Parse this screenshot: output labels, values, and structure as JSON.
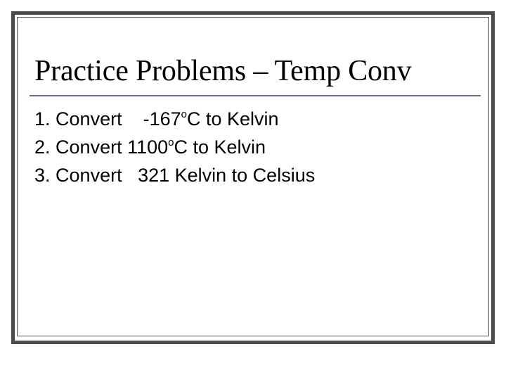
{
  "slide": {
    "title": "Practice Problems – Temp Conv",
    "problems": [
      {
        "number": "1.",
        "pre": " Convert    -167",
        "sup": "o",
        "post": "C to Kelvin"
      },
      {
        "number": "2.",
        "pre": " Convert 1100",
        "sup": "o",
        "post": "C to Kelvin"
      },
      {
        "number": "3.",
        "pre": " Convert   321 Kelvin to Celsius",
        "sup": "",
        "post": ""
      }
    ]
  },
  "colors": {
    "frame": "#4d4d4d",
    "title_rule": "#6b6b86",
    "text": "#000000",
    "background": "#ffffff"
  }
}
